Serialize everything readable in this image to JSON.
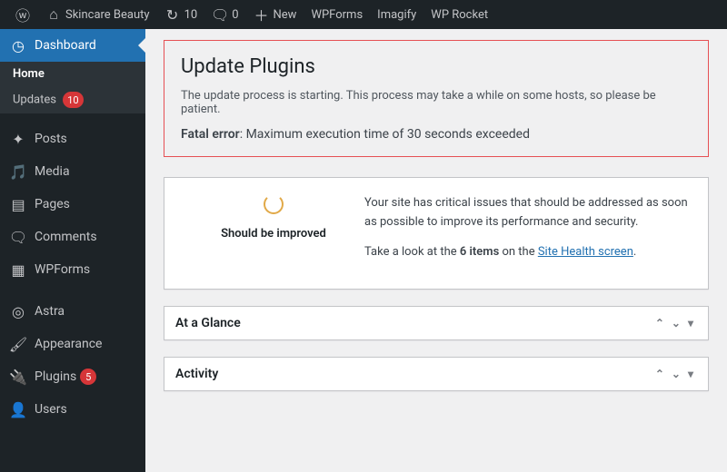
{
  "adminbar": {
    "site_name": "Skincare Beauty",
    "updates_count": "10",
    "comments_count": "0",
    "new_label": "New",
    "items": [
      "WPForms",
      "Imagify",
      "WP Rocket"
    ]
  },
  "sidebar": {
    "dashboard": "Dashboard",
    "home": "Home",
    "updates": "Updates",
    "updates_badge": "10",
    "posts": "Posts",
    "media": "Media",
    "pages": "Pages",
    "comments": "Comments",
    "wpforms": "WPForms",
    "astra": "Astra",
    "appearance": "Appearance",
    "plugins": "Plugins",
    "plugins_badge": "5",
    "users": "Users"
  },
  "error": {
    "title": "Update Plugins",
    "starting": "The update process is starting. This process may take a while on some hosts, so please be patient.",
    "fatal_prefix": "Fatal error",
    "fatal_msg": ": Maximum execution time of 30 seconds exceeded"
  },
  "health": {
    "status_label": "Should be improved",
    "line1": "Your site has critical issues that should be addressed as soon as possible to improve its performance and security.",
    "line2_a": "Take a look at the ",
    "line2_b": "6 items",
    "line2_c": " on the ",
    "link": "Site Health screen",
    "line2_d": "."
  },
  "boxes": {
    "glance": "At a Glance",
    "activity": "Activity"
  }
}
